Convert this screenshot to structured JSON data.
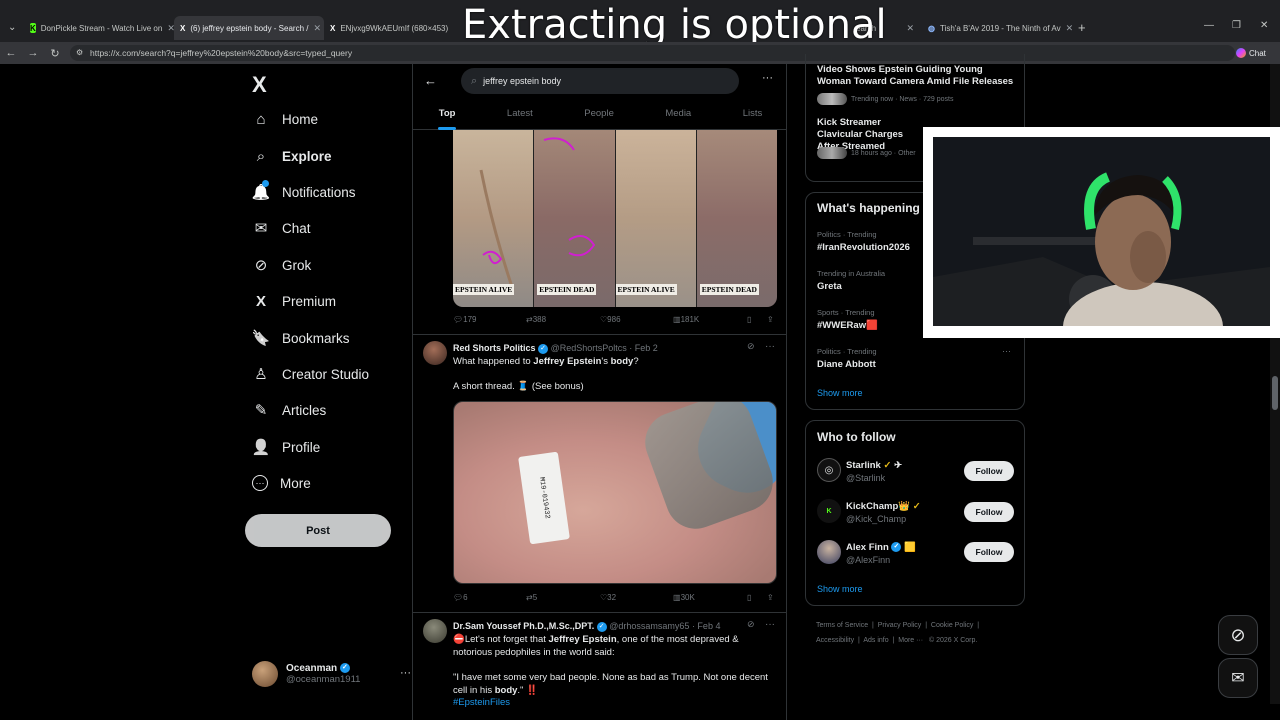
{
  "overlay_title": "Extracting is optional",
  "browser": {
    "tabs": [
      {
        "label": "DonPickle Stream - Watch Live on",
        "favicon": "K"
      },
      {
        "label": "(6) jeffrey epstein body - Search /",
        "favicon": "X"
      },
      {
        "label": "ENjvxg9WkAEUmIf (680×453)",
        "favicon": "X"
      },
      {
        "label": "Tish'a B'Av 2019 - The Ninth of Av",
        "favicon": "globe"
      }
    ],
    "partial_tab_text": "earch",
    "url": "https://x.com/search?q=jeffrey%20epstein%20body&src=typed_query",
    "chat_label": "Chat"
  },
  "sidebar": {
    "logo": "X",
    "items": [
      {
        "label": "Home",
        "icon": "home-icon",
        "glyph": "⌂"
      },
      {
        "label": "Explore",
        "icon": "search-icon",
        "glyph": "⌕"
      },
      {
        "label": "Notifications",
        "icon": "bell-icon",
        "glyph": "🔔"
      },
      {
        "label": "Chat",
        "icon": "mail-icon",
        "glyph": "✉"
      },
      {
        "label": "Grok",
        "icon": "grok-icon",
        "glyph": "⊘"
      },
      {
        "label": "Premium",
        "icon": "x-premium-icon",
        "glyph": "X"
      },
      {
        "label": "Bookmarks",
        "icon": "bookmark-icon",
        "glyph": "🔖"
      },
      {
        "label": "Creator Studio",
        "icon": "creator-studio-icon",
        "glyph": "♙"
      },
      {
        "label": "Articles",
        "icon": "articles-icon",
        "glyph": "✎"
      },
      {
        "label": "Profile",
        "icon": "profile-icon",
        "glyph": "👤"
      },
      {
        "label": "More",
        "icon": "more-circle-icon",
        "glyph": "⋯"
      }
    ],
    "post_label": "Post",
    "account": {
      "name": "Oceanman",
      "handle": "@oceanman1911"
    }
  },
  "search": {
    "query": "jeffrey epstein body",
    "tabs": [
      "Top",
      "Latest",
      "People",
      "Media",
      "Lists"
    ],
    "active_tab": "Top"
  },
  "tweets": [
    {
      "image_captions": [
        "EPSTEIN ALIVE",
        "EPSTEIN DEAD",
        "EPSTEIN ALIVE",
        "EPSTEIN DEAD"
      ],
      "replies": "179",
      "reposts": "388",
      "likes": "986",
      "views": "181K"
    },
    {
      "name": "Red Shorts Politics",
      "handle": "@RedShortsPoltcs",
      "date": "· Feb 2",
      "text_pre": "What happened to ",
      "text_bold": "Jeffrey Epstein",
      "text_mid": "'s ",
      "text_bold2": "body",
      "text_post": "?",
      "line2": "A short thread. 🧵 (See bonus)",
      "tag_text": "M19-019432",
      "replies": "6",
      "reposts": "5",
      "likes": "32",
      "views": "30K"
    },
    {
      "name": "Dr.Sam Youssef Ph.D.,M.Sc.,DPT.",
      "handle": "@drhossamsamy65",
      "date": "· Feb 4",
      "line1_pre": "⛔Let's not forget that ",
      "line1_bold": "Jeffrey Epstein",
      "line1_post": ", one of the most depraved &",
      "line2": "notorious pedophiles in the world said:",
      "quote_pre": "\"I have met some very bad people. None as bad as Trump. Not one decent cell in his ",
      "quote_bold": "body",
      "quote_post": ".\" ‼️",
      "hashtag": "#EpsteinFiles"
    }
  ],
  "right": {
    "news": [
      {
        "title": "Video Shows Epstein Guiding Young Woman Toward Camera Amid File Releases",
        "meta": "Trending now · News · 729 posts"
      },
      {
        "title": "Kick Streamer Clavicular Charges After Streamed",
        "meta": "18 hours ago · Other"
      }
    ],
    "happening_title": "What's happening",
    "trends": [
      {
        "context": "Politics · Trending",
        "name": "#IranRevolution2026"
      },
      {
        "context": "Trending in Australia",
        "name": "Greta"
      },
      {
        "context": "Sports · Trending",
        "name": "#WWERaw🟥"
      },
      {
        "context": "Politics · Trending",
        "name": "Diane Abbott"
      }
    ],
    "show_more": "Show more",
    "who_title": "Who to follow",
    "who": [
      {
        "name": "Starlink",
        "handle": "@Starlink",
        "suffix": "✈"
      },
      {
        "name": "KickChamp👑",
        "handle": "@Kick_Champ",
        "suffix": ""
      },
      {
        "name": "Alex Finn",
        "handle": "@AlexFinn",
        "suffix": "🟨"
      }
    ],
    "follow_label": "Follow",
    "footer": {
      "links": [
        "Terms of Service",
        "Privacy Policy",
        "Cookie Policy",
        "Accessibility",
        "Ads info",
        "More ···"
      ],
      "copyright": "© 2026 X Corp."
    }
  },
  "colors": {
    "accent": "#1d9bf0",
    "bg": "#000000",
    "text": "#e7e9ea",
    "muted": "#71767b"
  }
}
